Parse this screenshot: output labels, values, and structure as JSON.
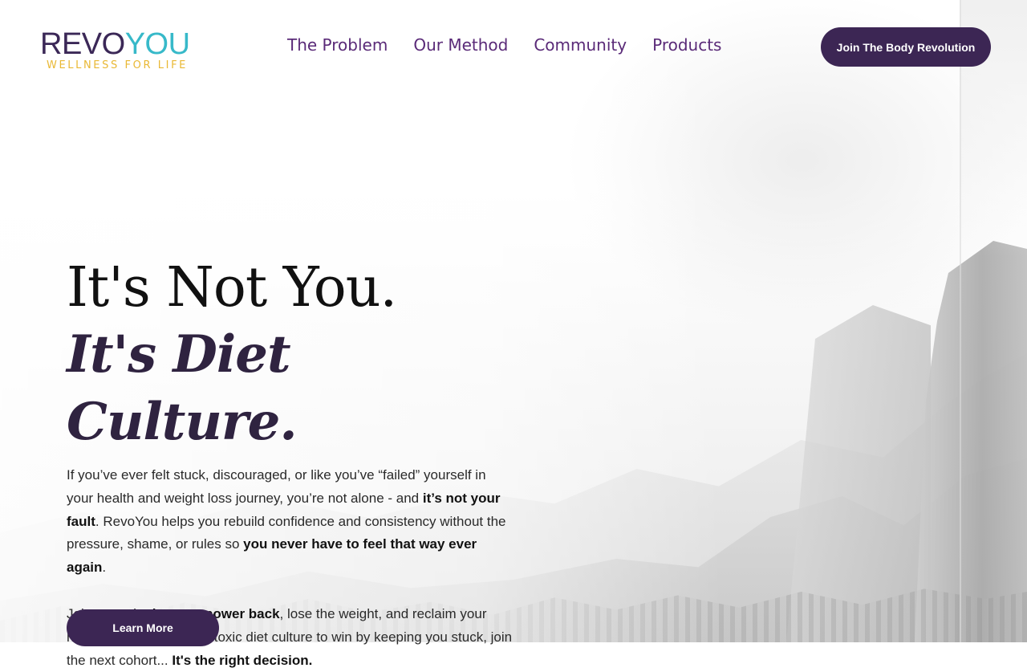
{
  "logo": {
    "word_part1": "REVO",
    "word_part2": "YOU",
    "tagline": "WELLNESS FOR LIFE",
    "colors": {
      "revo": "#3b2857",
      "you": "#37b9c9",
      "tagline": "#e9b834"
    }
  },
  "nav": {
    "items": [
      {
        "label": "The Problem"
      },
      {
        "label": "Our Method"
      },
      {
        "label": "Community"
      },
      {
        "label": "Products"
      }
    ]
  },
  "header_cta": {
    "label": "Join The Body Revolution"
  },
  "hero": {
    "title_line1": "It's Not You.",
    "title_line2": "It's Diet Culture.",
    "para1": {
      "t1": "If you’ve ever felt stuck, discouraged, or like you’ve “failed” yourself in your health and weight loss journey, you’re not alone - and ",
      "b1": "it’s not your fault",
      "t2": ".  RevoYou helps you rebuild confidence and consistency without the pressure, shame, or rules so ",
      "b2": "you never have to feel that way ever again",
      "t3": "."
    },
    "para2": {
      "t1": "Join us and ",
      "b1": "take your power back",
      "t2": ", lose the weight, and reclaim your health.  If you don't want toxic diet culture to win by keeping you stuck, join the next cohort... ",
      "b2": "It's the right decision."
    },
    "button_label": "Learn More"
  },
  "colors": {
    "primary": "#3c2654",
    "nav_text": "#5a2a78"
  }
}
